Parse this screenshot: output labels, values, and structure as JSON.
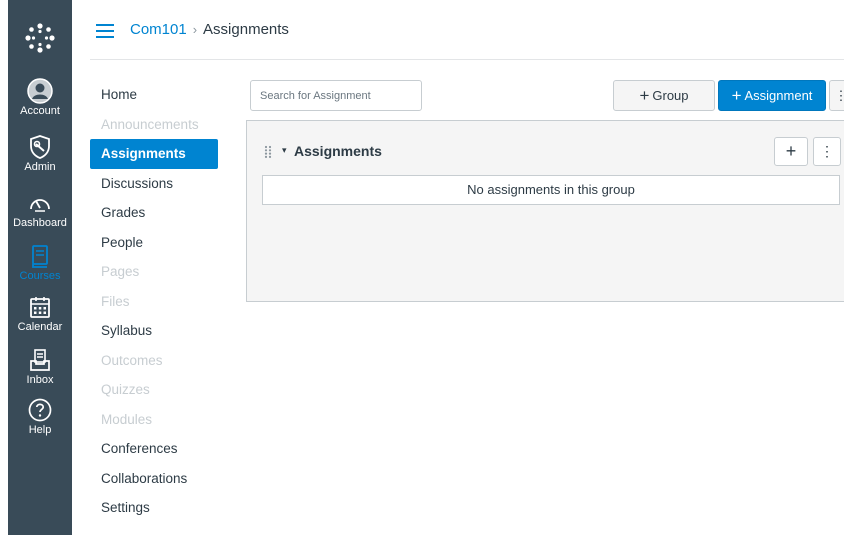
{
  "global_nav": {
    "items": [
      {
        "label": "Account",
        "icon": "account-icon"
      },
      {
        "label": "Admin",
        "icon": "admin-icon"
      },
      {
        "label": "Dashboard",
        "icon": "dashboard-icon"
      },
      {
        "label": "Courses",
        "icon": "courses-icon",
        "active": true
      },
      {
        "label": "Calendar",
        "icon": "calendar-icon"
      },
      {
        "label": "Inbox",
        "icon": "inbox-icon"
      },
      {
        "label": "Help",
        "icon": "help-icon"
      }
    ],
    "background": "#394b58",
    "active_color": "#0084d1"
  },
  "header": {
    "breadcrumb": {
      "course": "Com101",
      "separator": "›",
      "current": "Assignments"
    }
  },
  "course_nav": {
    "items": [
      {
        "label": "Home",
        "state": "enabled"
      },
      {
        "label": "Announcements",
        "state": "disabled"
      },
      {
        "label": "Assignments",
        "state": "active"
      },
      {
        "label": "Discussions",
        "state": "enabled"
      },
      {
        "label": "Grades",
        "state": "enabled"
      },
      {
        "label": "People",
        "state": "enabled"
      },
      {
        "label": "Pages",
        "state": "disabled"
      },
      {
        "label": "Files",
        "state": "disabled"
      },
      {
        "label": "Syllabus",
        "state": "enabled"
      },
      {
        "label": "Outcomes",
        "state": "disabled"
      },
      {
        "label": "Quizzes",
        "state": "disabled"
      },
      {
        "label": "Modules",
        "state": "disabled"
      },
      {
        "label": "Conferences",
        "state": "enabled"
      },
      {
        "label": "Collaborations",
        "state": "enabled"
      },
      {
        "label": "Settings",
        "state": "enabled"
      }
    ]
  },
  "toolbar": {
    "search_placeholder": "Search for Assignment",
    "group_button": "Group",
    "assignment_button": "Assignment",
    "plus_symbol": "+",
    "more_symbol": "⋮"
  },
  "assignment_group": {
    "title": "Assignments",
    "caret": "▾",
    "empty_message": "No assignments in this group",
    "add_symbol": "+",
    "more_symbol": "⋮"
  }
}
